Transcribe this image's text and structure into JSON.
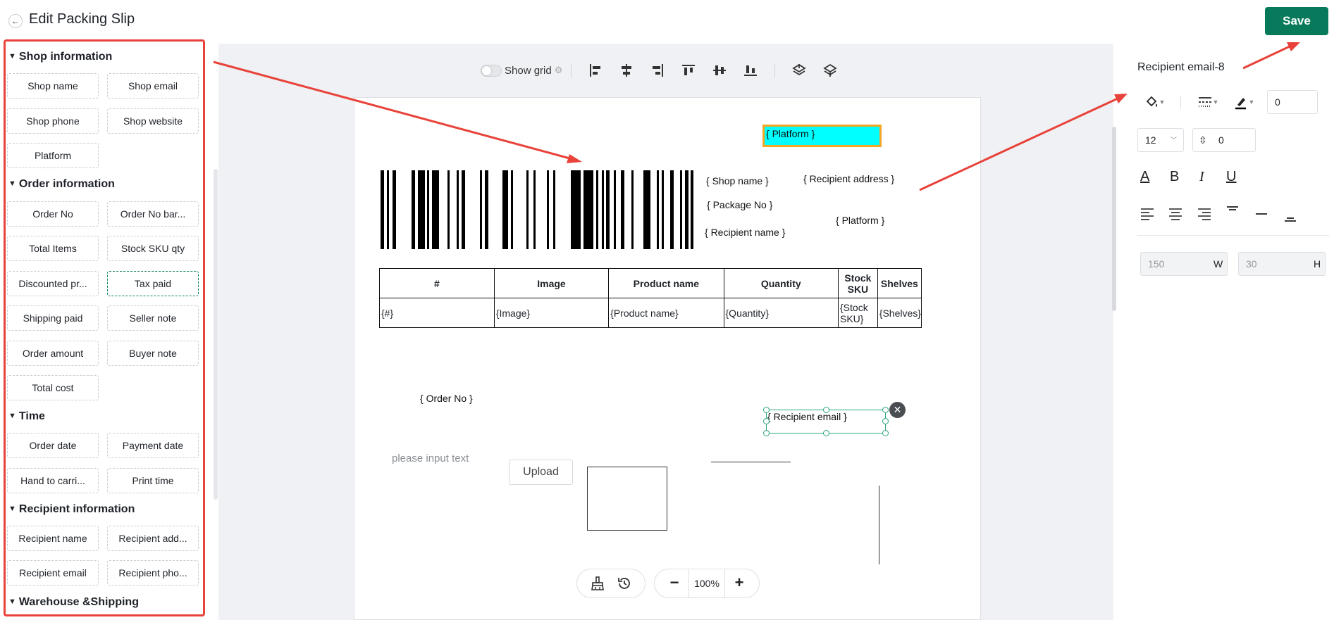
{
  "header": {
    "title": "Edit Packing Slip",
    "back_icon": "←",
    "save_label": "Save"
  },
  "left_panel": {
    "sections": [
      {
        "title": "Shop information",
        "items": [
          "Shop name",
          "Shop email",
          "Shop phone",
          "Shop website",
          "Platform"
        ]
      },
      {
        "title": "Order information",
        "items": [
          "Order No",
          "Order No bar...",
          "Total Items",
          "Stock SKU qty",
          "Discounted pr...",
          "Tax paid",
          "Shipping paid",
          "Seller note",
          "Order amount",
          "Buyer note",
          "Total cost"
        ]
      },
      {
        "title": "Time",
        "items": [
          "Order date",
          "Payment date",
          "Hand to carri...",
          "Print time"
        ]
      },
      {
        "title": "Recipient information",
        "items": [
          "Recipient name",
          "Recipient add...",
          "Recipient email",
          "Recipient pho..."
        ]
      },
      {
        "title": "Warehouse &Shipping",
        "items": []
      }
    ]
  },
  "toolbar": {
    "show_grid_label": "Show grid",
    "icons": [
      "align-left-icon",
      "align-center-icon",
      "align-right-icon",
      "align-top-icon",
      "align-middle-icon",
      "align-bottom-icon",
      "bring-forward-icon",
      "send-backward-icon"
    ]
  },
  "canvas": {
    "platform_top": "{ Platform }",
    "shop_name": "{ Shop name }",
    "package_no": "{ Package No }",
    "recipient_name": "{ Recipient name }",
    "recipient_address": "{ Recipient address }",
    "platform_mid": "{ Platform }",
    "table": {
      "headers": [
        "#",
        "Image",
        "Product name",
        "Quantity",
        "Stock SKU",
        "Shelves"
      ],
      "row": [
        "{#}",
        "{Image}",
        "{Product name}",
        "{Quantity}",
        "{Stock SKU}",
        "{Shelves}"
      ]
    },
    "order_no": "{ Order No }",
    "recipient_email": "{ Recipient email }",
    "close_icon": "✕",
    "placeholder_text": "please input text",
    "upload_label": "Upload"
  },
  "bottom_bar": {
    "zoom_out": "−",
    "zoom_value": "100%",
    "zoom_in": "+"
  },
  "right_panel": {
    "title": "Recipient email-8",
    "border_width": "0",
    "font_size": "12",
    "line_spacing": "0",
    "width": "150",
    "width_unit": "W",
    "height": "30",
    "height_unit": "H",
    "format": {
      "underline_color": "A",
      "bold": "B",
      "italic": "I",
      "underline": "U"
    }
  },
  "colors": {
    "accent": "#087a5b",
    "annotation": "#e8433a",
    "platform_fill": "#00ffff",
    "platform_border": "#f5a623"
  }
}
